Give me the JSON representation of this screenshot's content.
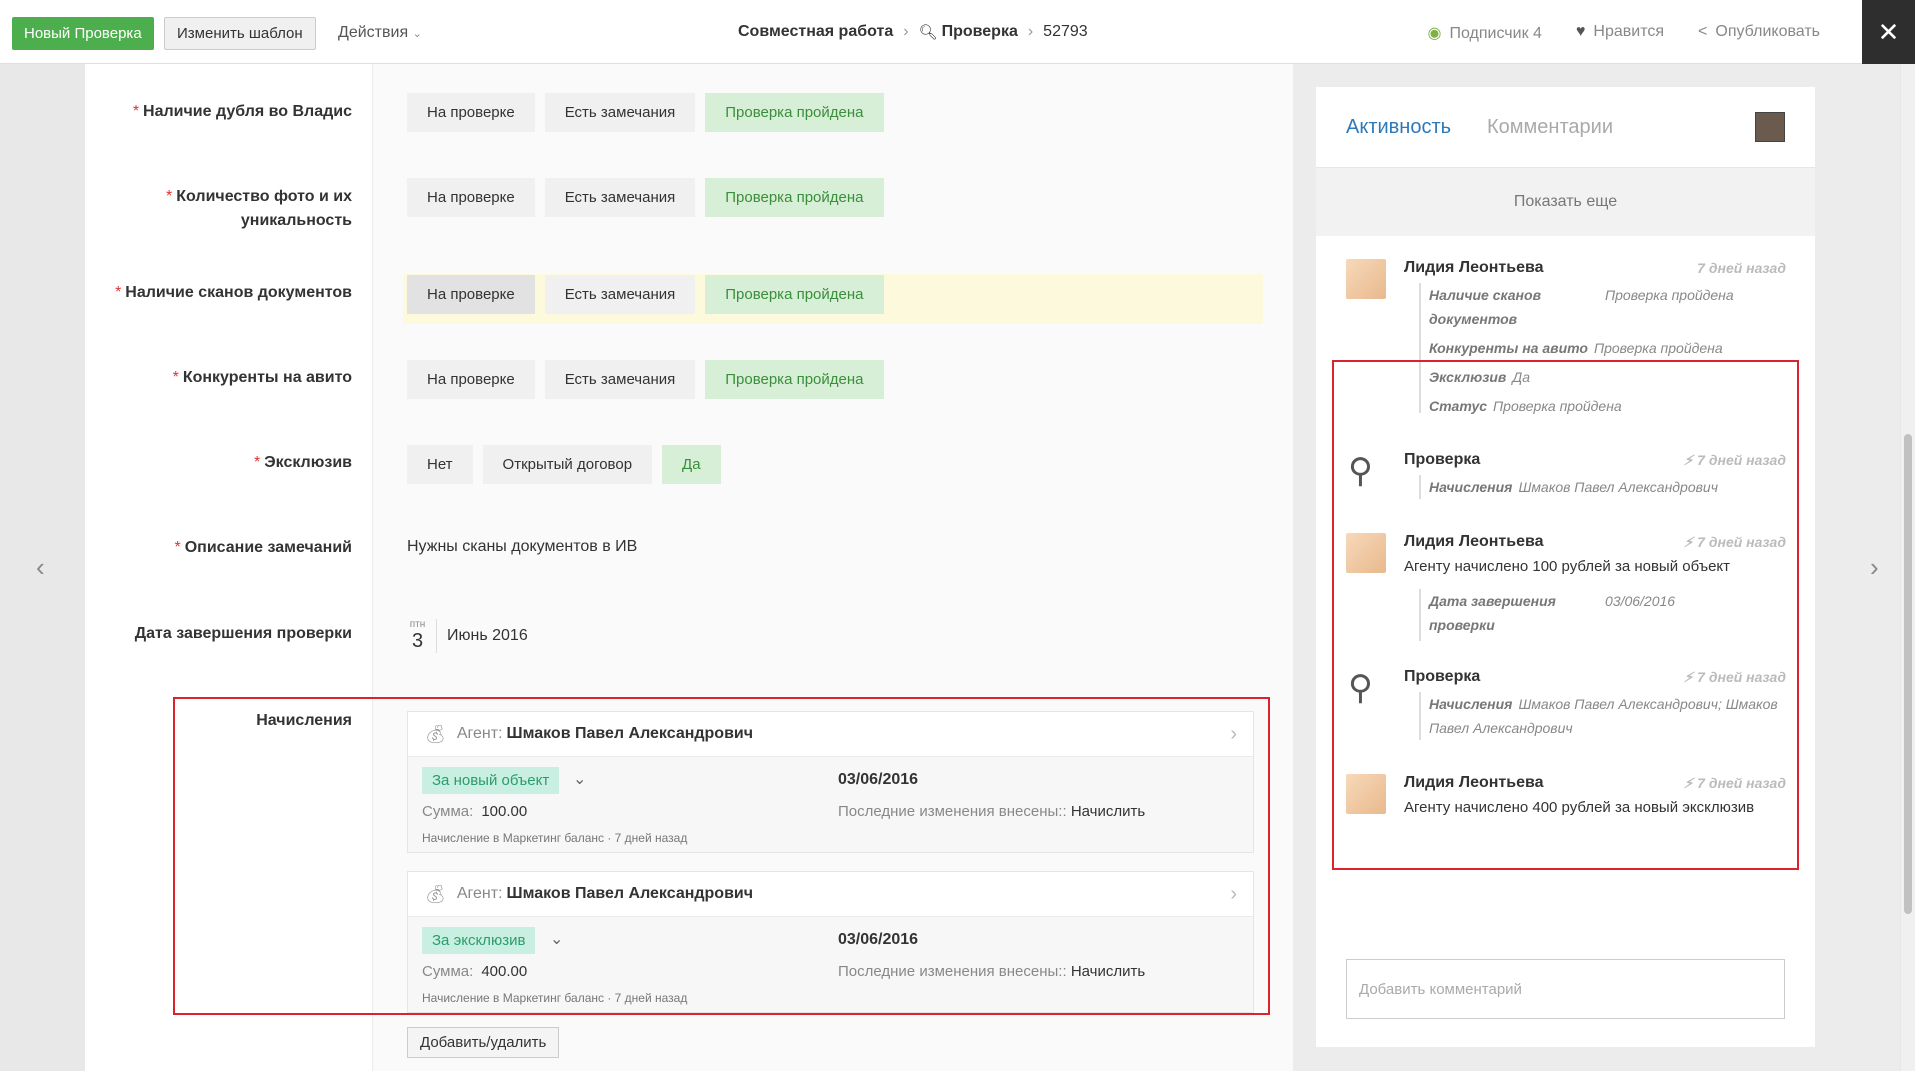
{
  "header": {
    "new_button": "Новый Проверка",
    "template_button": "Изменить шаблон",
    "actions": "Действия",
    "breadcrumb": [
      "Совместная работа",
      "Проверка",
      "52793"
    ],
    "subscriber_label": "Подписчик",
    "subscriber_count": "4",
    "like_label": "Нравится",
    "publish_label": "Опубликовать",
    "close": "✕"
  },
  "fields": [
    {
      "label": "Наличие дубля во Владис",
      "options": [
        "На проверке",
        "Есть замечания",
        "Проверка пройдена"
      ],
      "selected": "Проверка пройдена"
    },
    {
      "label": "Количество фото и их уникальность",
      "options": [
        "На проверке",
        "Есть замечания",
        "Проверка пройдена"
      ],
      "selected": "Проверка пройдена"
    },
    {
      "label": "Наличие сканов документов",
      "options": [
        "На проверке",
        "Есть замечания",
        "Проверка пройдена"
      ],
      "selected": "Проверка пройдена"
    },
    {
      "label": "Конкуренты на авито",
      "options": [
        "На проверке",
        "Есть замечания",
        "Проверка пройдена"
      ],
      "selected": "Проверка пройдена"
    },
    {
      "label": "Эксклюзив",
      "options": [
        "Нет",
        "Открытый договор",
        "Да"
      ],
      "selected": "Да"
    }
  ],
  "description": {
    "label": "Описание замечаний",
    "value": "Нужны сканы документов в ИВ"
  },
  "completion_date": {
    "label": "Дата завершения проверки",
    "weekday": "птн",
    "day": "3",
    "month_year": "Июнь 2016"
  },
  "accruals": {
    "label": "Начисления",
    "agent_prefix": "Агент:",
    "items": [
      {
        "agent": "Шмаков Павел Александрович",
        "type": "За новый объект",
        "sum_label": "Сумма:",
        "sum": "100.00",
        "note": "Начисление в Маркетинг баланс · 7 дней назад",
        "date": "03/06/2016",
        "last_label": "Последние изменения внесены::",
        "last_value": "Начислить"
      },
      {
        "agent": "Шмаков Павел Александрович",
        "type": "За эксклюзив",
        "sum_label": "Сумма:",
        "sum": "400.00",
        "note": "Начисление в Маркетинг баланс · 7 дней назад",
        "date": "03/06/2016",
        "last_label": "Последние изменения внесены::",
        "last_value": "Начислить"
      }
    ],
    "add_button": "Добавить/удалить"
  },
  "sidebar": {
    "tab_activity": "Активность",
    "tab_comments": "Комментарии",
    "show_more": "Показать еще",
    "entries": [
      {
        "author": "Лидия Леонтьева",
        "time": "7 дней назад"
      },
      {
        "author": "Проверка",
        "time": "7 дней назад"
      },
      {
        "author": "Лидия Леонтьева",
        "time": "7 дней назад"
      },
      {
        "author": "Проверка",
        "time": "7 дней назад"
      },
      {
        "author": "Лидия Леонтьева",
        "time": "7 дней назад"
      }
    ],
    "e1": {
      "k1": "Наличие сканов документов",
      "v1": "Проверка пройдена",
      "k2": "Конкуренты на авито",
      "v2": "Проверка пройдена",
      "k3": "Эксклюзив",
      "v3": "Да",
      "k4": "Статус",
      "v4": "Проверка пройдена"
    },
    "e2": {
      "k": "Начисления",
      "v": "Шмаков Павел Александрович"
    },
    "e3": {
      "text": "Агенту начислено 100 рублей за новый объект",
      "k": "Дата завершения проверки",
      "v": "03/06/2016"
    },
    "e4": {
      "k": "Начисления",
      "v": "Шмаков Павел Александрович; Шмаков Павел Александрович"
    },
    "e5": {
      "text": "Агенту начислено 400 рублей за новый эксклюзив"
    },
    "comment_placeholder": "Добавить комментарий"
  }
}
